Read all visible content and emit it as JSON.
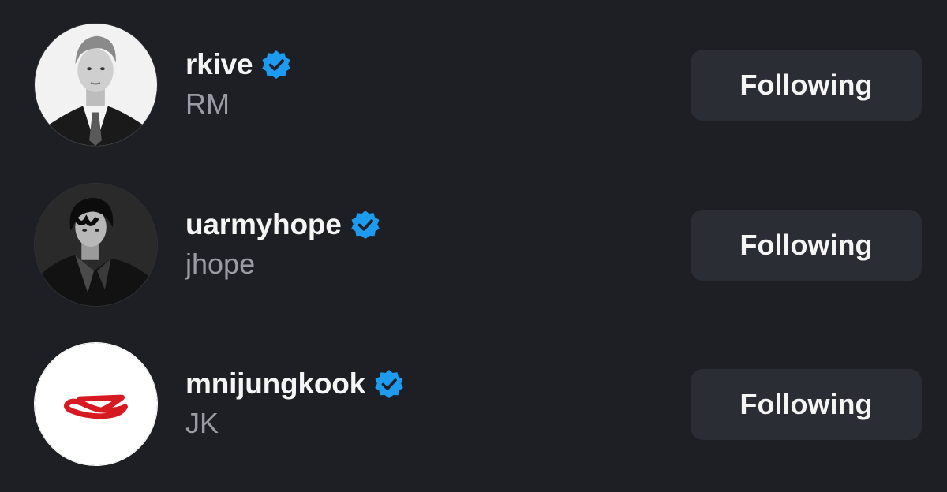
{
  "accounts": [
    {
      "username": "rkive",
      "full_name": "RM",
      "verified": true,
      "button_label": "Following",
      "avatar": "portrait-photo-suit"
    },
    {
      "username": "uarmyhope",
      "full_name": "jhope",
      "verified": true,
      "button_label": "Following",
      "avatar": "portrait-photo-leather-jacket"
    },
    {
      "username": "mnijungkook",
      "full_name": "JK",
      "verified": true,
      "button_label": "Following",
      "avatar": "red-logo-on-white"
    }
  ],
  "colors": {
    "background": "#1e1f24",
    "button_bg": "#2b2d34",
    "verified_badge": "#1d9bf0",
    "primary_text": "#f5f5f5",
    "secondary_text": "#9a9ca5",
    "logo_red": "#d71921"
  },
  "icons": {
    "verified": "verified-badge-icon"
  }
}
